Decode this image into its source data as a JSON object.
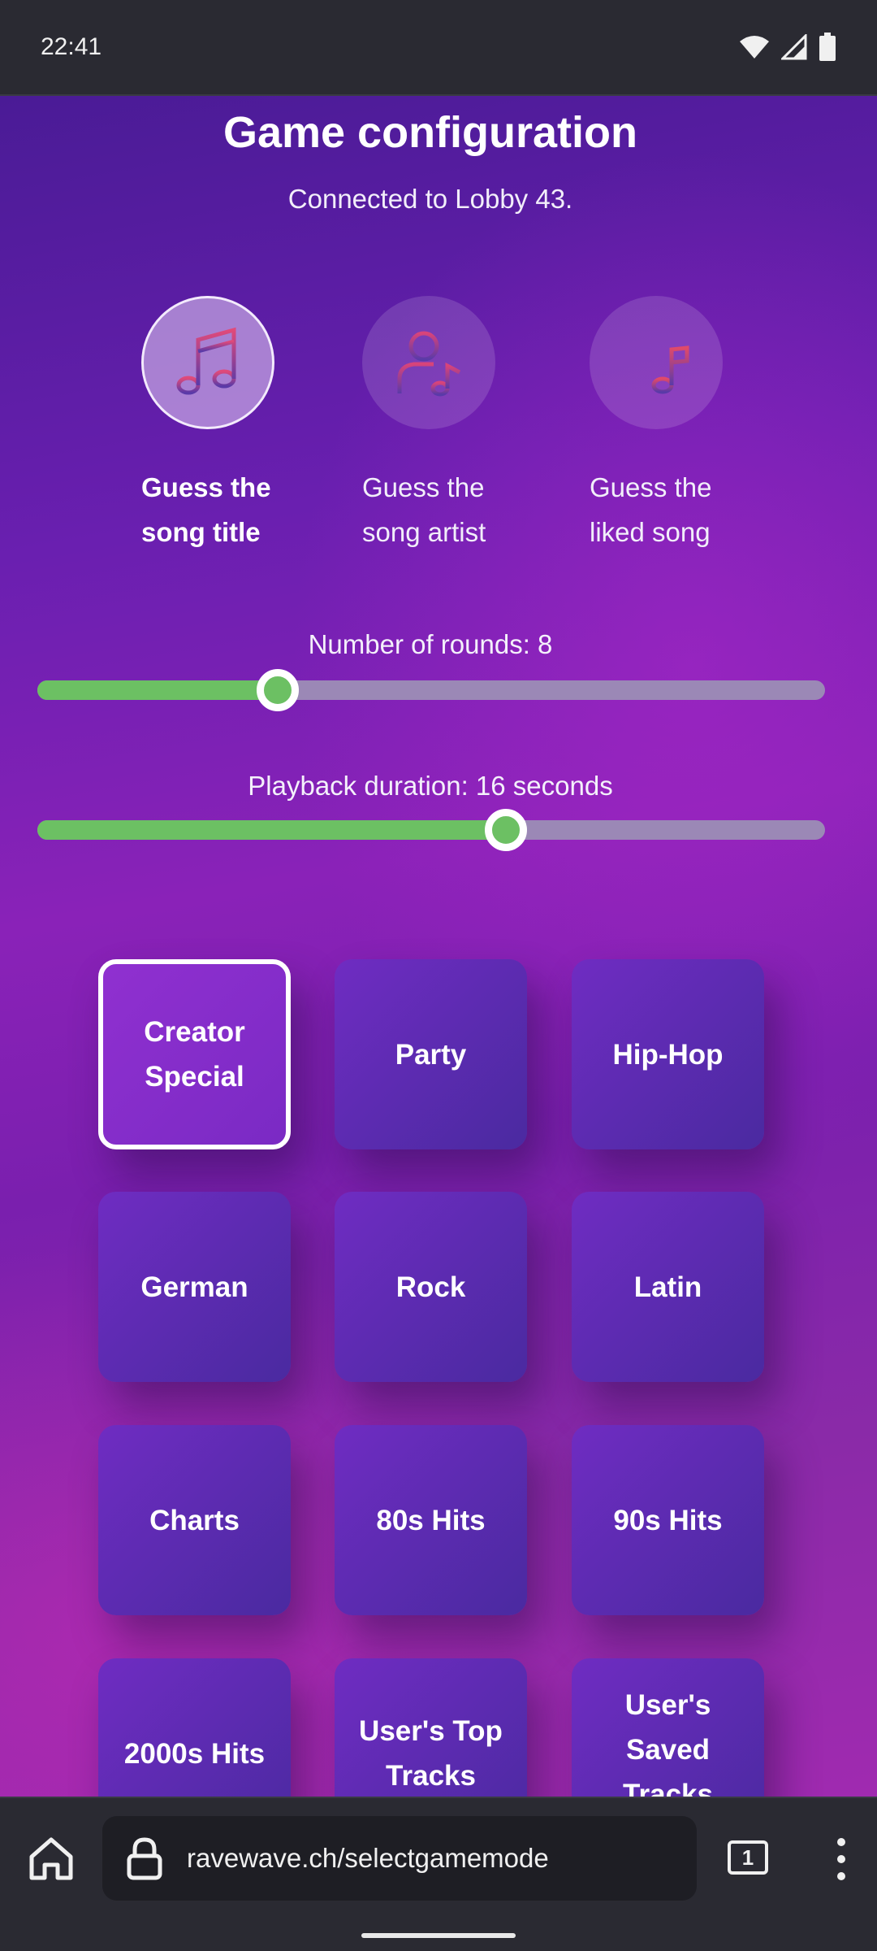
{
  "status_bar": {
    "time": "22:41"
  },
  "header": {
    "title": "Game configuration",
    "lobby_text": "Connected to Lobby 43."
  },
  "game_modes": [
    {
      "line1": "Guess the",
      "line2": "song title",
      "icon": "music-note-icon",
      "selected": true
    },
    {
      "line1": "Guess the",
      "line2": "song artist",
      "icon": "artist-icon",
      "selected": false
    },
    {
      "line1": "Guess the",
      "line2": "liked song",
      "icon": "playlist-icon",
      "selected": false
    }
  ],
  "rounds_slider": {
    "label": "Number of rounds: 8",
    "fraction": 0.305
  },
  "duration_slider": {
    "label": "Playback duration: 16 seconds",
    "fraction": 0.595
  },
  "playlists": [
    "Creator Special",
    "Party",
    "Hip-Hop",
    "German",
    "Rock",
    "Latin",
    "Charts",
    "80s Hits",
    "90s Hits",
    "2000s Hits",
    "User's Top Tracks",
    "User's Saved Tracks"
  ],
  "selected_playlist": "Creator Special",
  "browser": {
    "url": "ravewave.ch/selectgamemode",
    "tab_count": "1"
  },
  "colors": {
    "slider_fill": "#6cc063",
    "slider_track": "#9b88b6",
    "tile": "#5a2bb0",
    "selected_border": "#ffffff"
  }
}
